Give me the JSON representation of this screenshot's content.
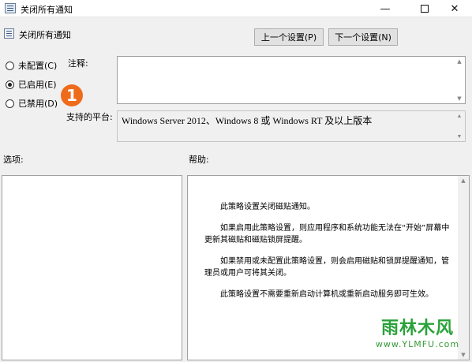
{
  "window": {
    "title": "关闭所有通知",
    "controls": {
      "minimize": "—",
      "maximize": "",
      "close": "✕"
    }
  },
  "header": {
    "title": "关闭所有通知",
    "prev_button": "上一个设置(P)",
    "next_button": "下一个设置(N)"
  },
  "state": {
    "options": [
      {
        "label": "未配置(C)",
        "checked": false
      },
      {
        "label": "已启用(E)",
        "checked": true
      },
      {
        "label": "已禁用(D)",
        "checked": false
      }
    ]
  },
  "annotation": {
    "badge": "1",
    "color": "#ef6b1c"
  },
  "fields": {
    "comment_label": "注释:",
    "comment_value": "",
    "platform_label": "支持的平台:",
    "platform_value": "Windows Server 2012、Windows 8 或 Windows RT 及以上版本"
  },
  "sections": {
    "options_label": "选项:",
    "help_label": "帮助:"
  },
  "help": {
    "paragraphs": [
      "此策略设置关闭磁贴通知。",
      "如果启用此策略设置，则应用程序和系统功能无法在“开始”屏幕中更新其磁贴和磁贴锁屏提醒。",
      "如果禁用或未配置此策略设置，则会启用磁贴和锁屏提醒通知，管理员或用户可将其关闭。",
      "此策略设置不需要重新启动计算机或重新启动服务即可生效。"
    ]
  },
  "watermark": {
    "name": "雨林木风",
    "url": "www.YLMFU.com"
  }
}
